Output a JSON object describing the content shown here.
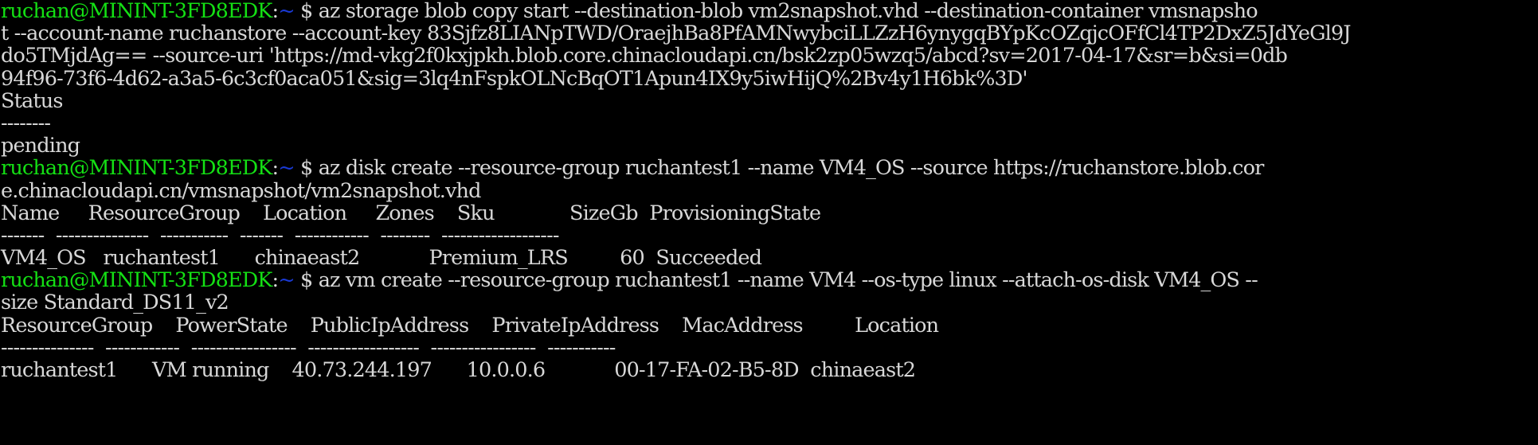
{
  "terminal": {
    "window_title": "ruchan@MININT-3FD8EDK",
    "colors": {
      "background": "#000000",
      "foreground": "#d8d8d8",
      "prompt_user_host": "#14e014",
      "prompt_cwd": "#1a3ad6"
    },
    "prompt": {
      "user_host": "ruchan@MININT-3FD8EDK",
      "separator": ":",
      "cwd": "~",
      "sigil": "$"
    },
    "lines": [
      {
        "type": "prompt",
        "command": " az storage blob copy start --destination-blob vm2snapshot.vhd --destination-container vmsnapsho"
      },
      {
        "type": "output",
        "text": "t --account-name ruchanstore --account-key 83Sjfz8LIANpTWD/OraejhBa8PfAMNwybciLLZzH6ynygqBYpKcOZqjcOFfCl4TP2DxZ5JdYeGl9J"
      },
      {
        "type": "output",
        "text": "do5TMjdAg== --source-uri 'https://md-vkg2f0kxjpkh.blob.core.chinacloudapi.cn/bsk2zp05wzq5/abcd?sv=2017-04-17&sr=b&si=0db"
      },
      {
        "type": "output",
        "text": "94f96-73f6-4d62-a3a5-6c3cf0aca051&sig=3lq4nFspkOLNcBqOT1Apun4IX9y5iwHijQ%2Bv4y1H6bk%3D'"
      },
      {
        "type": "output",
        "text": "Status"
      },
      {
        "type": "output",
        "text": "--------"
      },
      {
        "type": "output",
        "text": "pending"
      },
      {
        "type": "prompt",
        "command": " az disk create --resource-group ruchantest1 --name VM4_OS --source https://ruchanstore.blob.cor"
      },
      {
        "type": "output",
        "text": "e.chinacloudapi.cn/vmsnapshot/vm2snapshot.vhd"
      },
      {
        "type": "output",
        "text": "Name     ResourceGroup    Location     Zones    Sku             SizeGb  ProvisioningState"
      },
      {
        "type": "output",
        "text": "-------  ---------------  -----------  -------  ------------  --------  -------------------"
      },
      {
        "type": "output",
        "text": "VM4_OS   ruchantest1      chinaeast2            Premium_LRS         60  Succeeded"
      },
      {
        "type": "prompt",
        "command": " az vm create --resource-group ruchantest1 --name VM4 --os-type linux --attach-os-disk VM4_OS --"
      },
      {
        "type": "output",
        "text": "size Standard_DS11_v2"
      },
      {
        "type": "output",
        "text": "ResourceGroup    PowerState    PublicIpAddress    PrivateIpAddress    MacAddress         Location"
      },
      {
        "type": "output",
        "text": "---------------  ------------  -----------------  ------------------  -----------------  -----------"
      },
      {
        "type": "output",
        "text": "ruchantest1      VM running    40.73.244.197      10.0.0.6            00-17-FA-02-B5-8D  chinaeast2"
      }
    ],
    "tables": {
      "disk_create": {
        "columns": [
          "Name",
          "ResourceGroup",
          "Location",
          "Zones",
          "Sku",
          "SizeGb",
          "ProvisioningState"
        ],
        "rows": [
          [
            "VM4_OS",
            "ruchantest1",
            "chinaeast2",
            "",
            "Premium_LRS",
            "60",
            "Succeeded"
          ]
        ]
      },
      "vm_create": {
        "columns": [
          "ResourceGroup",
          "PowerState",
          "PublicIpAddress",
          "PrivateIpAddress",
          "MacAddress",
          "Location"
        ],
        "rows": [
          [
            "ruchantest1",
            "VM running",
            "40.73.244.197",
            "10.0.0.6",
            "00-17-FA-02-B5-8D",
            "chinaeast2"
          ]
        ]
      },
      "blob_copy": {
        "columns": [
          "Status"
        ],
        "rows": [
          [
            "pending"
          ]
        ]
      }
    }
  }
}
